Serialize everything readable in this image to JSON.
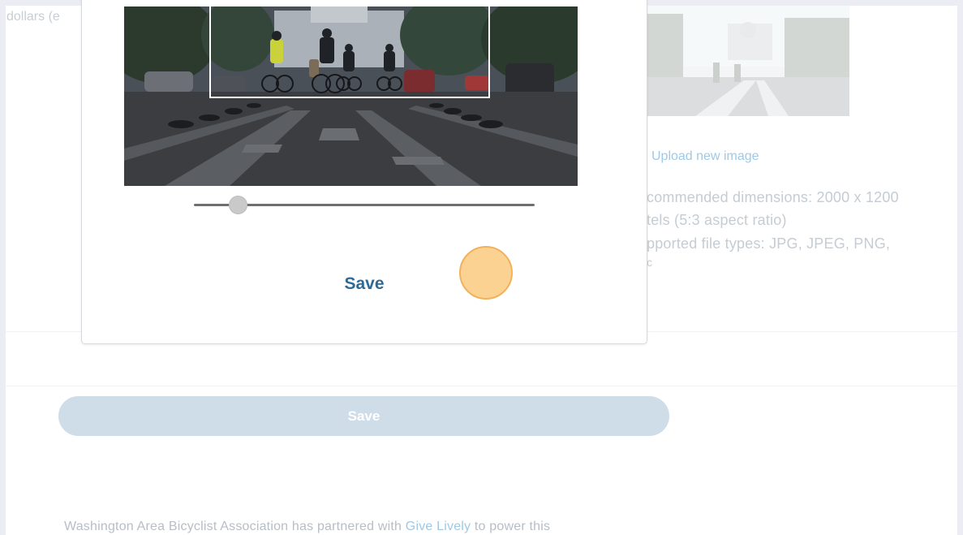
{
  "background_form": {
    "field_label": "dollars (e",
    "upload_link": "Upload new image",
    "hint_lines": [
      "commended dimensions: 2000 x 1200",
      "tels (5:3 aspect ratio)",
      "pported file types: JPG, JPEG, PNG,",
      "c"
    ],
    "save_label": "Save"
  },
  "footer": {
    "text_before": "Washington Area Bicyclist Association has partnered with ",
    "link": "Give Lively",
    "text_after": " to power this"
  },
  "crop_modal": {
    "zoom_level": 0.13,
    "save_label": "Save"
  },
  "colors": {
    "accent": "#2f6a96",
    "link": "#9fc9e6",
    "disabled_button": "#cfdde8",
    "click_indicator": "#f7c47a"
  }
}
